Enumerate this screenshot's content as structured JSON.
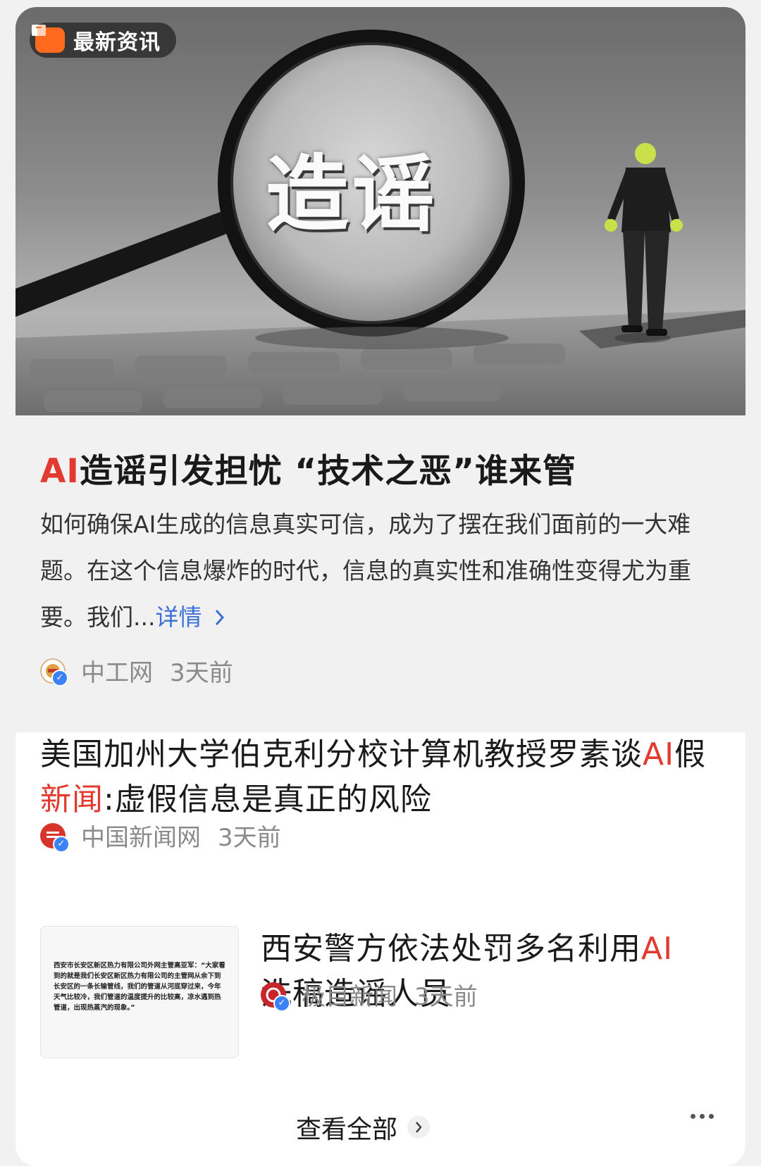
{
  "hero": {
    "badge_label": "最新资讯",
    "image_word": "造谣"
  },
  "featured": {
    "title_highlight": "AI",
    "title_rest": "造谣引发担忧 “技术之恶”谁来管",
    "summary": "如何确保AI生成的信息真实可信，成为了摆在我们面前的一大难题。在这个信息爆炸的时代，信息的真实性和准确性变得尤为重要。我们...",
    "more_label": "详情",
    "source": "中工网",
    "time": "3天前"
  },
  "news2": {
    "title_part1": "美国加州大学伯克利分校计算机教授罗素谈",
    "title_hl1": "AI",
    "title_part2": "假",
    "title_hl2": "新闻",
    "title_part3": ":虚假信息是真正的风险",
    "source": "中国新闻网",
    "time": "3天前"
  },
  "news3": {
    "title_part1": "西安警方依法处罚多名利用",
    "title_hl1": "AI",
    "title_part2": "洗稿造谣人员",
    "thumbnail_text": "西安市长安区新区热力有限公司外网主管高亚军：“大家看到的就是我们长安区新区热力有限公司的主管网从余下到长安区的一条长输管线，我们的管道从河底穿过来，今年天气比较冷，我们管道的温度提升的比较高，凉水遇到热管道，出现热蒸汽的现象。”",
    "source": "极目新闻",
    "time": "3天前"
  },
  "footer": {
    "view_all_label": "查看全部"
  },
  "colors": {
    "highlight": "#e23a2e",
    "link": "#3c6fd8",
    "badge_icon": "#ff6a1f",
    "verified": "#3b82f6"
  },
  "icons": [
    "news-badge-icon",
    "chevron-right-icon",
    "verified-icon",
    "more-dots-icon"
  ]
}
